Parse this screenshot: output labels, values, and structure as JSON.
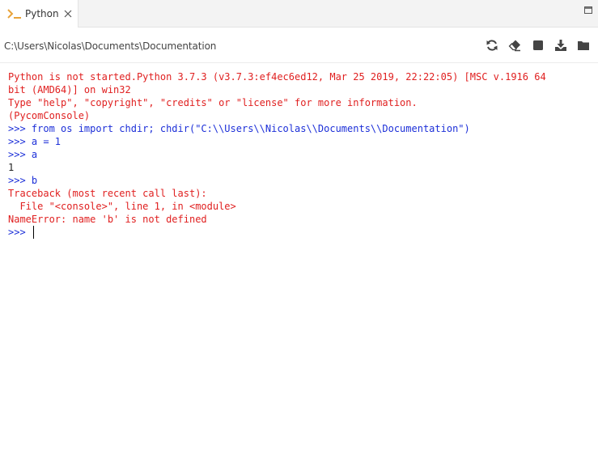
{
  "colors": {
    "error_text": "#e02020",
    "input_text": "#1c2fd8",
    "output_text": "#222222",
    "tab_icon_orange": "#e8a33a"
  },
  "tab": {
    "label": "Python",
    "icon": "terminal-prompt-icon",
    "close_icon": "close-icon"
  },
  "window": {
    "maximize_icon": "maximize-icon"
  },
  "toolbar": {
    "path": "C:\\Users\\Nicolas\\Documents\\Documentation",
    "icons": [
      "refresh-icon",
      "eraser-icon",
      "stop-icon",
      "download-icon",
      "folder-icon"
    ]
  },
  "console": {
    "lines": [
      {
        "kind": "err",
        "text": "Python is not started.Python 3.7.3 (v3.7.3:ef4ec6ed12, Mar 25 2019, 22:22:05) [MSC v.1916 64"
      },
      {
        "kind": "err",
        "text": "bit (AMD64)] on win32"
      },
      {
        "kind": "err",
        "text": "Type \"help\", \"copyright\", \"credits\" or \"license\" for more information."
      },
      {
        "kind": "err",
        "text": "(PycomConsole)"
      },
      {
        "kind": "inp",
        "text": ">>> from os import chdir; chdir(\"C:\\\\Users\\\\Nicolas\\\\Documents\\\\Documentation\")"
      },
      {
        "kind": "inp",
        "text": ">>> a = 1"
      },
      {
        "kind": "inp",
        "text": ">>> a"
      },
      {
        "kind": "out",
        "text": "1"
      },
      {
        "kind": "inp",
        "text": ">>> b"
      },
      {
        "kind": "err",
        "text": "Traceback (most recent call last):"
      },
      {
        "kind": "err",
        "text": "  File \"<console>\", line 1, in <module>"
      },
      {
        "kind": "err",
        "text": "NameError: name 'b' is not defined"
      },
      {
        "kind": "inp",
        "text": ">>> "
      }
    ]
  }
}
